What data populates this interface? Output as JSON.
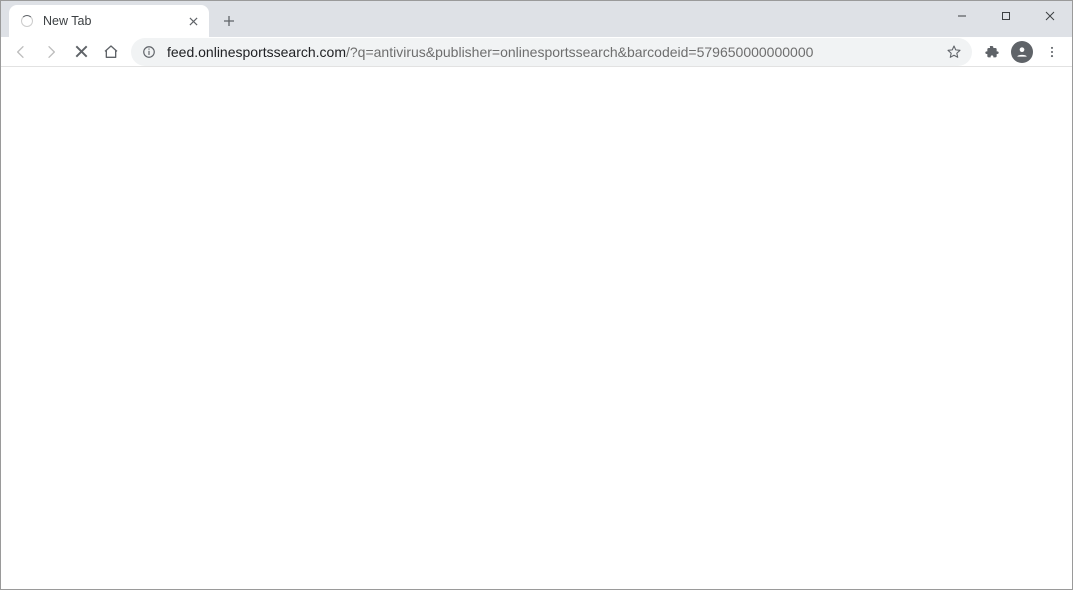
{
  "tab": {
    "title": "New Tab",
    "loading": true
  },
  "url": {
    "host": "feed.onlinesportssearch.com",
    "path": "/?q=antivirus&publisher=onlinesportssearch&barcodeid=579650000000000"
  },
  "nav": {
    "back_enabled": false,
    "forward_enabled": false
  }
}
